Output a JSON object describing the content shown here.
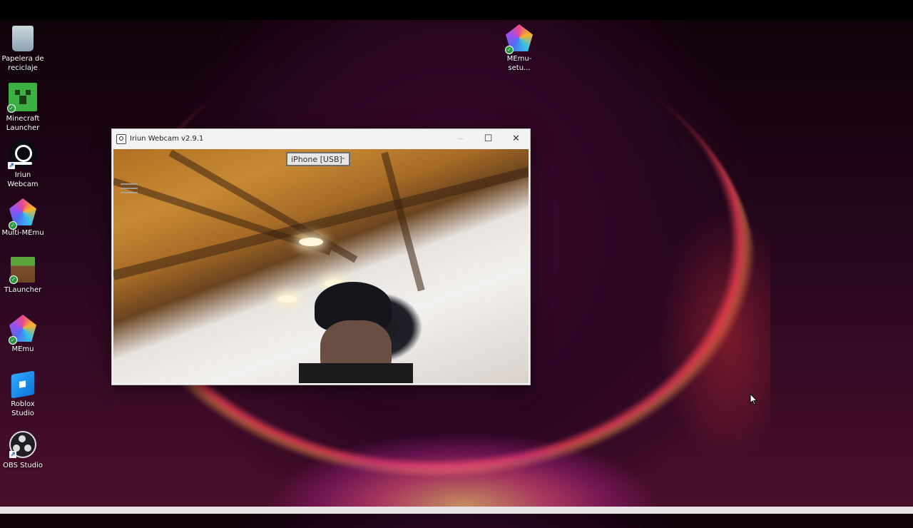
{
  "desktop": {
    "icons": [
      {
        "label": "Papelera de reciclaje",
        "icon": "recycle-bin-icon"
      },
      {
        "label": "Minecraft Launcher",
        "icon": "minecraft-icon"
      },
      {
        "label": "Iriun Webcam",
        "icon": "iriun-webcam-icon"
      },
      {
        "label": "Multi-MEmu",
        "icon": "multi-memu-icon"
      },
      {
        "label": "TLauncher",
        "icon": "tlauncher-icon"
      },
      {
        "label": "MEmu",
        "icon": "memu-icon"
      },
      {
        "label": "Roblox Studio",
        "icon": "roblox-studio-icon"
      },
      {
        "label": "OBS Studio",
        "icon": "obs-studio-icon"
      },
      {
        "label": "MEmu-setu...",
        "icon": "memu-setup-icon"
      }
    ]
  },
  "window": {
    "title": "Iriun Webcam v2.9.1",
    "minimize": "—",
    "maximize": "☐",
    "close": "✕",
    "device_select": {
      "value": "iPhone [USB]",
      "chevron": "⌄"
    }
  }
}
